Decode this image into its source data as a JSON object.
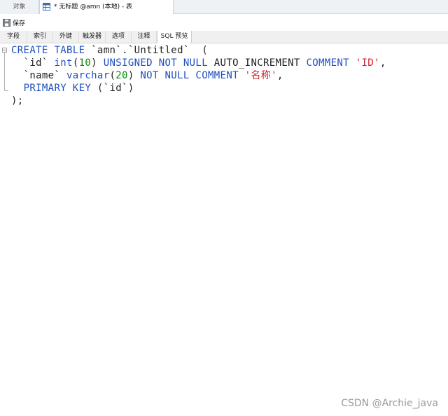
{
  "doc_tabs": {
    "objects_label": "对象",
    "active_title": "* 无标题 @amn (本地) - 表"
  },
  "toolbar": {
    "save_label": "保存"
  },
  "sub_tabs": [
    {
      "label": "字段"
    },
    {
      "label": "索引"
    },
    {
      "label": "外键"
    },
    {
      "label": "触发器"
    },
    {
      "label": "选项"
    },
    {
      "label": "注释"
    },
    {
      "label": "SQL 预览",
      "active": true
    }
  ],
  "sql": {
    "line1": {
      "kw1": "CREATE",
      "kw2": "TABLE",
      "schema": "`amn`",
      "dot": ".",
      "table": "`Untitled`",
      "open": "("
    },
    "line2": {
      "col": "`id`",
      "type": "int",
      "lp": "(",
      "len": "10",
      "rp": ")",
      "kw1": "UNSIGNED",
      "kw2": "NOT",
      "kw3": "NULL",
      "auto": "AUTO_INCREMENT",
      "kw4": "COMMENT",
      "comment": "'ID'",
      "comma": ","
    },
    "line3": {
      "col": "`name`",
      "type": "varchar",
      "lp": "(",
      "len": "20",
      "rp": ")",
      "kw1": "NOT",
      "kw2": "NULL",
      "kw3": "COMMENT",
      "comment": "'名称'",
      "comma": ","
    },
    "line4": {
      "kw1": "PRIMARY",
      "kw2": "KEY",
      "cols": "(`id`)"
    },
    "line5": {
      "close": ");"
    }
  },
  "watermark": "CSDN @Archie_java",
  "colors": {
    "keyword": "#1f4fbf",
    "number": "#0b8a0b",
    "string": "#d4212e"
  }
}
